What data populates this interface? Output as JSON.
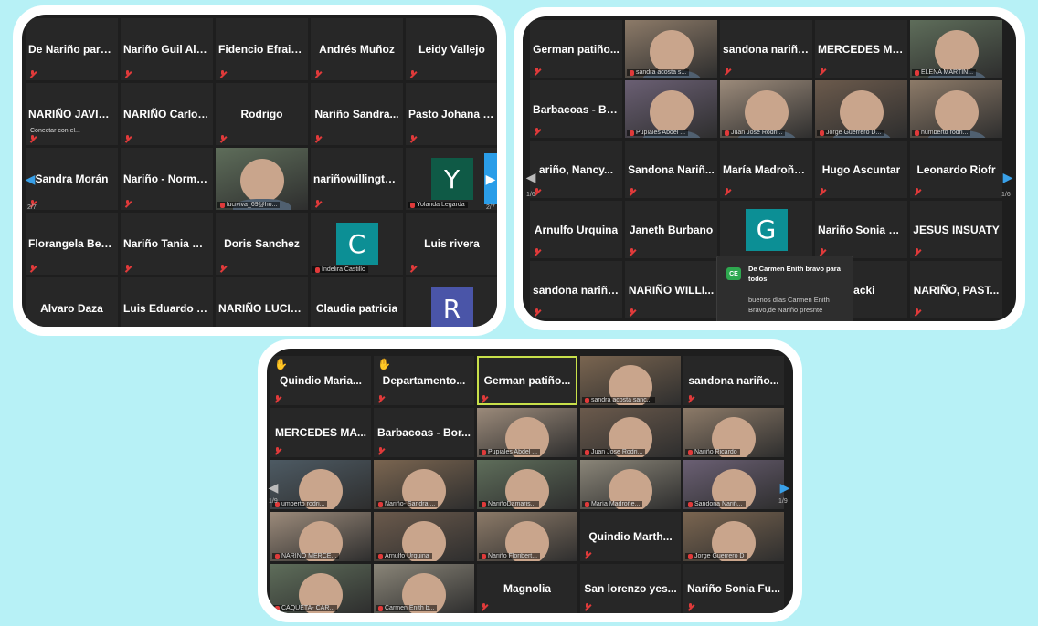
{
  "screen1": {
    "page_left": "2/7",
    "page_right": "2/7",
    "tiles": [
      {
        "name": "De Nariño para...",
        "kind": "name"
      },
      {
        "name": "Nariño Guil Alfr...",
        "kind": "name"
      },
      {
        "name": "Fidencio Efrain...",
        "kind": "name"
      },
      {
        "name": "Andrés Muñoz",
        "kind": "name"
      },
      {
        "name": "Leidy Vallejo",
        "kind": "name"
      },
      {
        "name": "NARIÑO JAVIER...",
        "kind": "name",
        "caption": "Conectar con el..."
      },
      {
        "name": "NARIÑO Carlos...",
        "kind": "name"
      },
      {
        "name": "Rodrigo",
        "kind": "name"
      },
      {
        "name": "Nariño Sandra...",
        "kind": "name"
      },
      {
        "name": "Pasto Johana R...",
        "kind": "name"
      },
      {
        "name": "Sandra Morán",
        "kind": "name"
      },
      {
        "name": "Nariño - Norma...",
        "kind": "name"
      },
      {
        "name": "luciviva_69@ho...",
        "kind": "video"
      },
      {
        "name": "nariñowillingto...",
        "kind": "name"
      },
      {
        "name": "Yolanda Legarda",
        "kind": "avatar",
        "letter": "Y",
        "color": "#0f5a46"
      },
      {
        "name": "Florangela Ben...",
        "kind": "name"
      },
      {
        "name": "Nariño Tania M...",
        "kind": "name"
      },
      {
        "name": "Doris Sanchez",
        "kind": "name"
      },
      {
        "name": "Indelira Castillo",
        "kind": "avatar",
        "letter": "C",
        "color": "#0c8f95"
      },
      {
        "name": "Luis rivera",
        "kind": "name"
      },
      {
        "name": "Alvaro Daza",
        "kind": "name"
      },
      {
        "name": "Luis Eduardo Ri...",
        "kind": "name"
      },
      {
        "name": "NARIÑO LUCIA...",
        "kind": "name"
      },
      {
        "name": "Claudia patricia",
        "kind": "name"
      },
      {
        "name": "",
        "kind": "avatar",
        "letter": "R",
        "color": "#4a55a8"
      }
    ]
  },
  "screen2": {
    "page_left": "1/6",
    "page_right": "1/6",
    "tiles": [
      {
        "name": "German patiño...",
        "kind": "name"
      },
      {
        "name": "sandra acosta s...",
        "kind": "video",
        "highlight": true
      },
      {
        "name": "sandona nariño...",
        "kind": "name"
      },
      {
        "name": "MERCEDES MA...",
        "kind": "name"
      },
      {
        "name": "ELENA MARTIN...",
        "kind": "video"
      },
      {
        "name": "Barbacoas - Bor...",
        "kind": "name"
      },
      {
        "name": "Pupiales Abdel ...",
        "kind": "video"
      },
      {
        "name": "Juan Jose Rodri...",
        "kind": "video"
      },
      {
        "name": "Jorge Guerrero D...",
        "kind": "video"
      },
      {
        "name": "humberto rodri...",
        "kind": "video"
      },
      {
        "name": "ariño, Nancy...",
        "kind": "name"
      },
      {
        "name": "Sandona Nariñ...",
        "kind": "name"
      },
      {
        "name": "María Madroñero",
        "kind": "name"
      },
      {
        "name": "Hugo Ascuntar",
        "kind": "name"
      },
      {
        "name": "Leonardo Riofr",
        "kind": "name"
      },
      {
        "name": "Arnulfo Urquina",
        "kind": "name"
      },
      {
        "name": "Janeth Burbano",
        "kind": "name"
      },
      {
        "name": "",
        "kind": "avatar",
        "letter": "G",
        "color": "#0c8f95"
      },
      {
        "name": "Nariño Sonia Fu...",
        "kind": "name"
      },
      {
        "name": "JESUS INSUATY",
        "kind": "name"
      },
      {
        "name": "sandona nariño...",
        "kind": "name"
      },
      {
        "name": "NARIÑO WILLI...",
        "kind": "name"
      },
      {
        "name": "",
        "kind": "name"
      },
      {
        "name": "Jacki",
        "kind": "name"
      },
      {
        "name": "NARIÑO, PAST...",
        "kind": "name"
      }
    ],
    "chat": {
      "badge": "CE",
      "from": "De Carmen Enith bravo para todos",
      "message": "buenos días Carmen Enith Bravo,de Nariño presnte"
    }
  },
  "screen3": {
    "page_left": "1/9",
    "page_right": "1/9",
    "tiles": [
      {
        "name": "Quindio Maria...",
        "kind": "name",
        "hand": true
      },
      {
        "name": "Departamento...",
        "kind": "name",
        "hand": true
      },
      {
        "name": "German patiño...",
        "kind": "name",
        "highlight": true
      },
      {
        "name": "sandra acosta sanc...",
        "kind": "video"
      },
      {
        "name": "sandona nariño...",
        "kind": "name"
      },
      {
        "name": "MERCEDES MA...",
        "kind": "name"
      },
      {
        "name": "Barbacoas - Bor...",
        "kind": "name"
      },
      {
        "name": "Pupiales Abdel ...",
        "kind": "video"
      },
      {
        "name": "Juan Jose Rodri...",
        "kind": "video"
      },
      {
        "name": "Nariño Ricardo",
        "kind": "video"
      },
      {
        "name": "umberto rodri...",
        "kind": "video"
      },
      {
        "name": "Nariño- Sandra ...",
        "kind": "video"
      },
      {
        "name": "NariñoDamaris...",
        "kind": "video"
      },
      {
        "name": "María Madroñe...",
        "kind": "video"
      },
      {
        "name": "Sandona Nariñ...",
        "kind": "video"
      },
      {
        "name": "NARIÑO MERCE...",
        "kind": "video"
      },
      {
        "name": "Arnulfo Urquina",
        "kind": "video"
      },
      {
        "name": "Nariño Floribert...",
        "kind": "video"
      },
      {
        "name": "Quindio Marth...",
        "kind": "name"
      },
      {
        "name": "Jorge Guerrero D",
        "kind": "video"
      },
      {
        "name": "CAQUETA- CAR...",
        "kind": "video"
      },
      {
        "name": "Carmen Enith b...",
        "kind": "video"
      },
      {
        "name": "Magnolia",
        "kind": "name"
      },
      {
        "name": "San lorenzo yes...",
        "kind": "name"
      },
      {
        "name": "Nariño Sonia Fu...",
        "kind": "name"
      }
    ]
  }
}
